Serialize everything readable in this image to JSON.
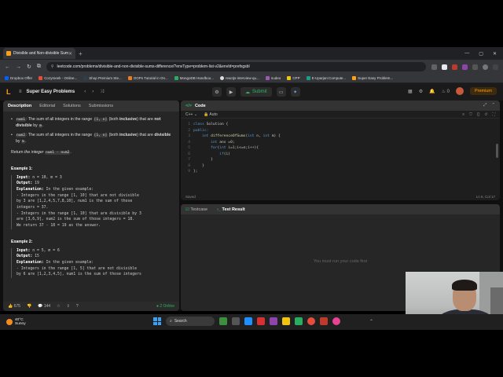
{
  "browser": {
    "tab_title": "Divisible and Non-divisible Sum",
    "url": "leetcode.com/problems/divisible-and-non-divisible-sums-difference/?envType=problem-list-v2&envId=prefxgsbl",
    "bookmarks": [
      "Dropbox Offer",
      "Cozymeek - Online...",
      "Shop Premium Ste...",
      "OOPs Tutorial in On...",
      "MongoDB Handboo...",
      "reactjs-interview-qu...",
      "nudeo",
      "CPP",
      "E-Uparjan:Compute...",
      "Super Easy Problem..."
    ]
  },
  "header": {
    "logo": "L",
    "problem_list": "Super Easy Problems",
    "submit_label": "Submit",
    "premium_label": "Premium",
    "streak": "0"
  },
  "left": {
    "tabs": [
      "Description",
      "Editorial",
      "Solutions",
      "Submissions"
    ],
    "bullet1_pre": "num1",
    "bullet1_text": ": The sum of all integers in the range ",
    "bullet1_range": "[1, n]",
    "bullet1_mid": " (both ",
    "bullet1_bold": "inclusive",
    "bullet1_tail": ") that are ",
    "bullet1_bold2": "not divisible",
    "bullet1_end": " by ",
    "bullet1_m": "m",
    "bullet2_pre": "num2",
    "bullet2_text": ": The sum of all integers in the range ",
    "bullet2_range": "[1, n]",
    "bullet2_mid": " (both ",
    "bullet2_bold": "inclusive",
    "bullet2_tail": ") that are ",
    "bullet2_bold2": "divisible",
    "bullet2_end": " by ",
    "bullet2_m": "m",
    "return_pre": "Return ",
    "return_em": "the integer",
    "return_code": "num1 - num2",
    "return_end": ".",
    "example1_title": "Example 1:",
    "example1_lines": [
      {
        "label": "Input:",
        "text": " n = 10, m = 3"
      },
      {
        "label": "Output:",
        "text": " 19"
      },
      {
        "label": "Explanation:",
        "text": " In the given example:"
      },
      {
        "label": "",
        "text": "- Integers in the range [1, 10] that are not divisible"
      },
      {
        "label": "",
        "text": "by 3 are [1,2,4,5,7,8,10], num1 is the sum of those"
      },
      {
        "label": "",
        "text": "integers = 37."
      },
      {
        "label": "",
        "text": "- Integers in the range [1, 10] that are divisible by 3"
      },
      {
        "label": "",
        "text": "are [3,6,9], num2 is the sum of those integers = 18."
      },
      {
        "label": "",
        "text": "We return 37 - 18 = 19 as the answer."
      }
    ],
    "example2_title": "Example 2:",
    "example2_lines": [
      {
        "label": "Input:",
        "text": " n = 5, m = 6"
      },
      {
        "label": "Output:",
        "text": " 15"
      },
      {
        "label": "Explanation:",
        "text": " In the given example:"
      },
      {
        "label": "",
        "text": "- Integers in the range [1, 5] that are not divisible"
      },
      {
        "label": "",
        "text": "by 6 are [1,2,3,4,5], num1 is the sum of those integers"
      }
    ],
    "likes": "675",
    "comments": "144",
    "online": "2 Online"
  },
  "code": {
    "title": "Code",
    "language": "C++",
    "mode": "Auto",
    "saved": "Saved",
    "position": "Ln 6, Col 17",
    "lines": [
      "class Solution {",
      "public:",
      "    int differenceOfSums(int n, int m) {",
      "        int ans =0;",
      "        for(int i=1;i<=n;i++){",
      "            if(i)",
      "        }",
      "    }",
      "};"
    ]
  },
  "test": {
    "tab_testcase": "Testcase",
    "tab_result": "Test Result",
    "empty_msg": "You must run your code first"
  },
  "taskbar": {
    "temp": "40°C",
    "weather": "Sunny",
    "search": "Search"
  },
  "colors": {
    "accent_orange": "#ffa116",
    "accent_green": "#2db55d",
    "panel_bg": "#262626"
  }
}
